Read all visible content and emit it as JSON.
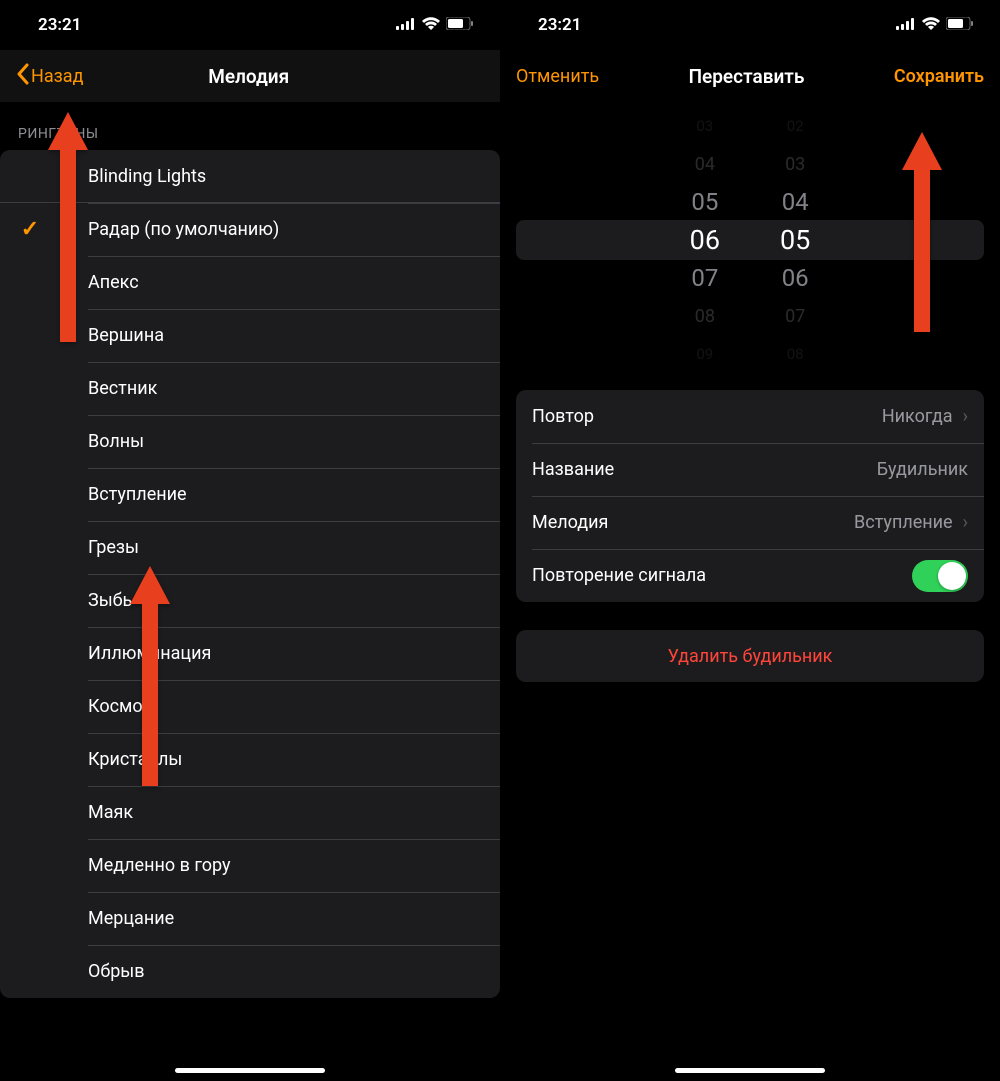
{
  "status": {
    "time": "23:21"
  },
  "left": {
    "nav": {
      "back": "Назад",
      "title": "Мелодия"
    },
    "section_header": "РИНГТОНЫ",
    "ringtones": [
      {
        "label": "Blinding Lights",
        "checked": false
      },
      {
        "label": "Радар (по умолчанию)",
        "checked": true
      },
      {
        "label": "Апекс",
        "checked": false
      },
      {
        "label": "Вершина",
        "checked": false
      },
      {
        "label": "Вестник",
        "checked": false
      },
      {
        "label": "Волны",
        "checked": false
      },
      {
        "label": "Вступление",
        "checked": false
      },
      {
        "label": "Грезы",
        "checked": false
      },
      {
        "label": "Зыбь",
        "checked": false
      },
      {
        "label": "Иллюминация",
        "checked": false
      },
      {
        "label": "Космос",
        "checked": false
      },
      {
        "label": "Кристаллы",
        "checked": false
      },
      {
        "label": "Маяк",
        "checked": false
      },
      {
        "label": "Медленно в гору",
        "checked": false
      },
      {
        "label": "Мерцание",
        "checked": false
      },
      {
        "label": "Обрыв",
        "checked": false
      }
    ]
  },
  "right": {
    "nav": {
      "cancel": "Отменить",
      "title": "Переставить",
      "save": "Сохранить"
    },
    "picker": {
      "hours": [
        "03",
        "04",
        "05",
        "06",
        "07",
        "08",
        "09"
      ],
      "minutes": [
        "02",
        "03",
        "04",
        "05",
        "06",
        "07",
        "08"
      ],
      "selected_hour": "06",
      "selected_minute": "05"
    },
    "settings": {
      "repeat_label": "Повтор",
      "repeat_value": "Никогда",
      "name_label": "Название",
      "name_value": "Будильник",
      "sound_label": "Мелодия",
      "sound_value": "Вступление",
      "snooze_label": "Повторение сигнала",
      "snooze_on": true
    },
    "delete": "Удалить будильник"
  }
}
